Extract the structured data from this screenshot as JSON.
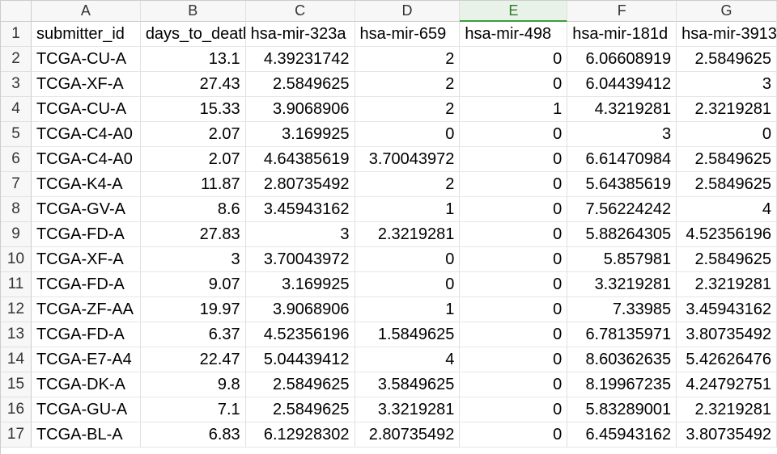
{
  "columns": [
    {
      "letter": "A",
      "class": "cA",
      "align": "txt"
    },
    {
      "letter": "B",
      "class": "cB",
      "align": "num"
    },
    {
      "letter": "C",
      "class": "cC",
      "align": "num"
    },
    {
      "letter": "D",
      "class": "cD",
      "align": "num"
    },
    {
      "letter": "E",
      "class": "cE",
      "align": "num"
    },
    {
      "letter": "F",
      "class": "cF",
      "align": "num"
    },
    {
      "letter": "G",
      "class": "cG",
      "align": "num"
    }
  ],
  "selected_column": "E",
  "header_row": {
    "number": 1,
    "cells": [
      "submitter_id",
      "days_to_death",
      "hsa-mir-323a",
      "hsa-mir-659",
      "hsa-mir-498",
      "hsa-mir-181d",
      "hsa-mir-3913"
    ]
  },
  "data_rows": [
    {
      "number": 2,
      "cells": [
        "TCGA-CU-A",
        "13.1",
        "4.39231742",
        "2",
        "0",
        "6.06608919",
        "2.5849625"
      ]
    },
    {
      "number": 3,
      "cells": [
        "TCGA-XF-A",
        "27.43",
        "2.5849625",
        "2",
        "0",
        "6.04439412",
        "3"
      ]
    },
    {
      "number": 4,
      "cells": [
        "TCGA-CU-A",
        "15.33",
        "3.9068906",
        "2",
        "1",
        "4.3219281",
        "2.3219281"
      ]
    },
    {
      "number": 5,
      "cells": [
        "TCGA-C4-A0",
        "2.07",
        "3.169925",
        "0",
        "0",
        "3",
        "0"
      ]
    },
    {
      "number": 6,
      "cells": [
        "TCGA-C4-A0",
        "2.07",
        "4.64385619",
        "3.70043972",
        "0",
        "6.61470984",
        "2.5849625"
      ]
    },
    {
      "number": 7,
      "cells": [
        "TCGA-K4-A",
        "11.87",
        "2.80735492",
        "2",
        "0",
        "5.64385619",
        "2.5849625"
      ]
    },
    {
      "number": 8,
      "cells": [
        "TCGA-GV-A",
        "8.6",
        "3.45943162",
        "1",
        "0",
        "7.56224242",
        "4"
      ]
    },
    {
      "number": 9,
      "cells": [
        "TCGA-FD-A",
        "27.83",
        "3",
        "2.3219281",
        "0",
        "5.88264305",
        "4.52356196"
      ]
    },
    {
      "number": 10,
      "cells": [
        "TCGA-XF-A",
        "3",
        "3.70043972",
        "0",
        "0",
        "5.857981",
        "2.5849625"
      ]
    },
    {
      "number": 11,
      "cells": [
        "TCGA-FD-A",
        "9.07",
        "3.169925",
        "0",
        "0",
        "3.3219281",
        "2.3219281"
      ]
    },
    {
      "number": 12,
      "cells": [
        "TCGA-ZF-AA",
        "19.97",
        "3.9068906",
        "1",
        "0",
        "7.33985",
        "3.45943162"
      ]
    },
    {
      "number": 13,
      "cells": [
        "TCGA-FD-A",
        "6.37",
        "4.52356196",
        "1.5849625",
        "0",
        "6.78135971",
        "3.80735492"
      ]
    },
    {
      "number": 14,
      "cells": [
        "TCGA-E7-A4",
        "22.47",
        "5.04439412",
        "4",
        "0",
        "8.60362635",
        "5.42626476"
      ]
    },
    {
      "number": 15,
      "cells": [
        "TCGA-DK-A",
        "9.8",
        "2.5849625",
        "3.5849625",
        "0",
        "8.19967235",
        "4.24792751"
      ]
    },
    {
      "number": 16,
      "cells": [
        "TCGA-GU-A",
        "7.1",
        "2.5849625",
        "3.3219281",
        "0",
        "5.83289001",
        "2.3219281"
      ]
    },
    {
      "number": 17,
      "cells": [
        "TCGA-BL-A",
        "6.83",
        "6.12928302",
        "2.80735492",
        "0",
        "6.45943162",
        "3.80735492"
      ]
    }
  ]
}
